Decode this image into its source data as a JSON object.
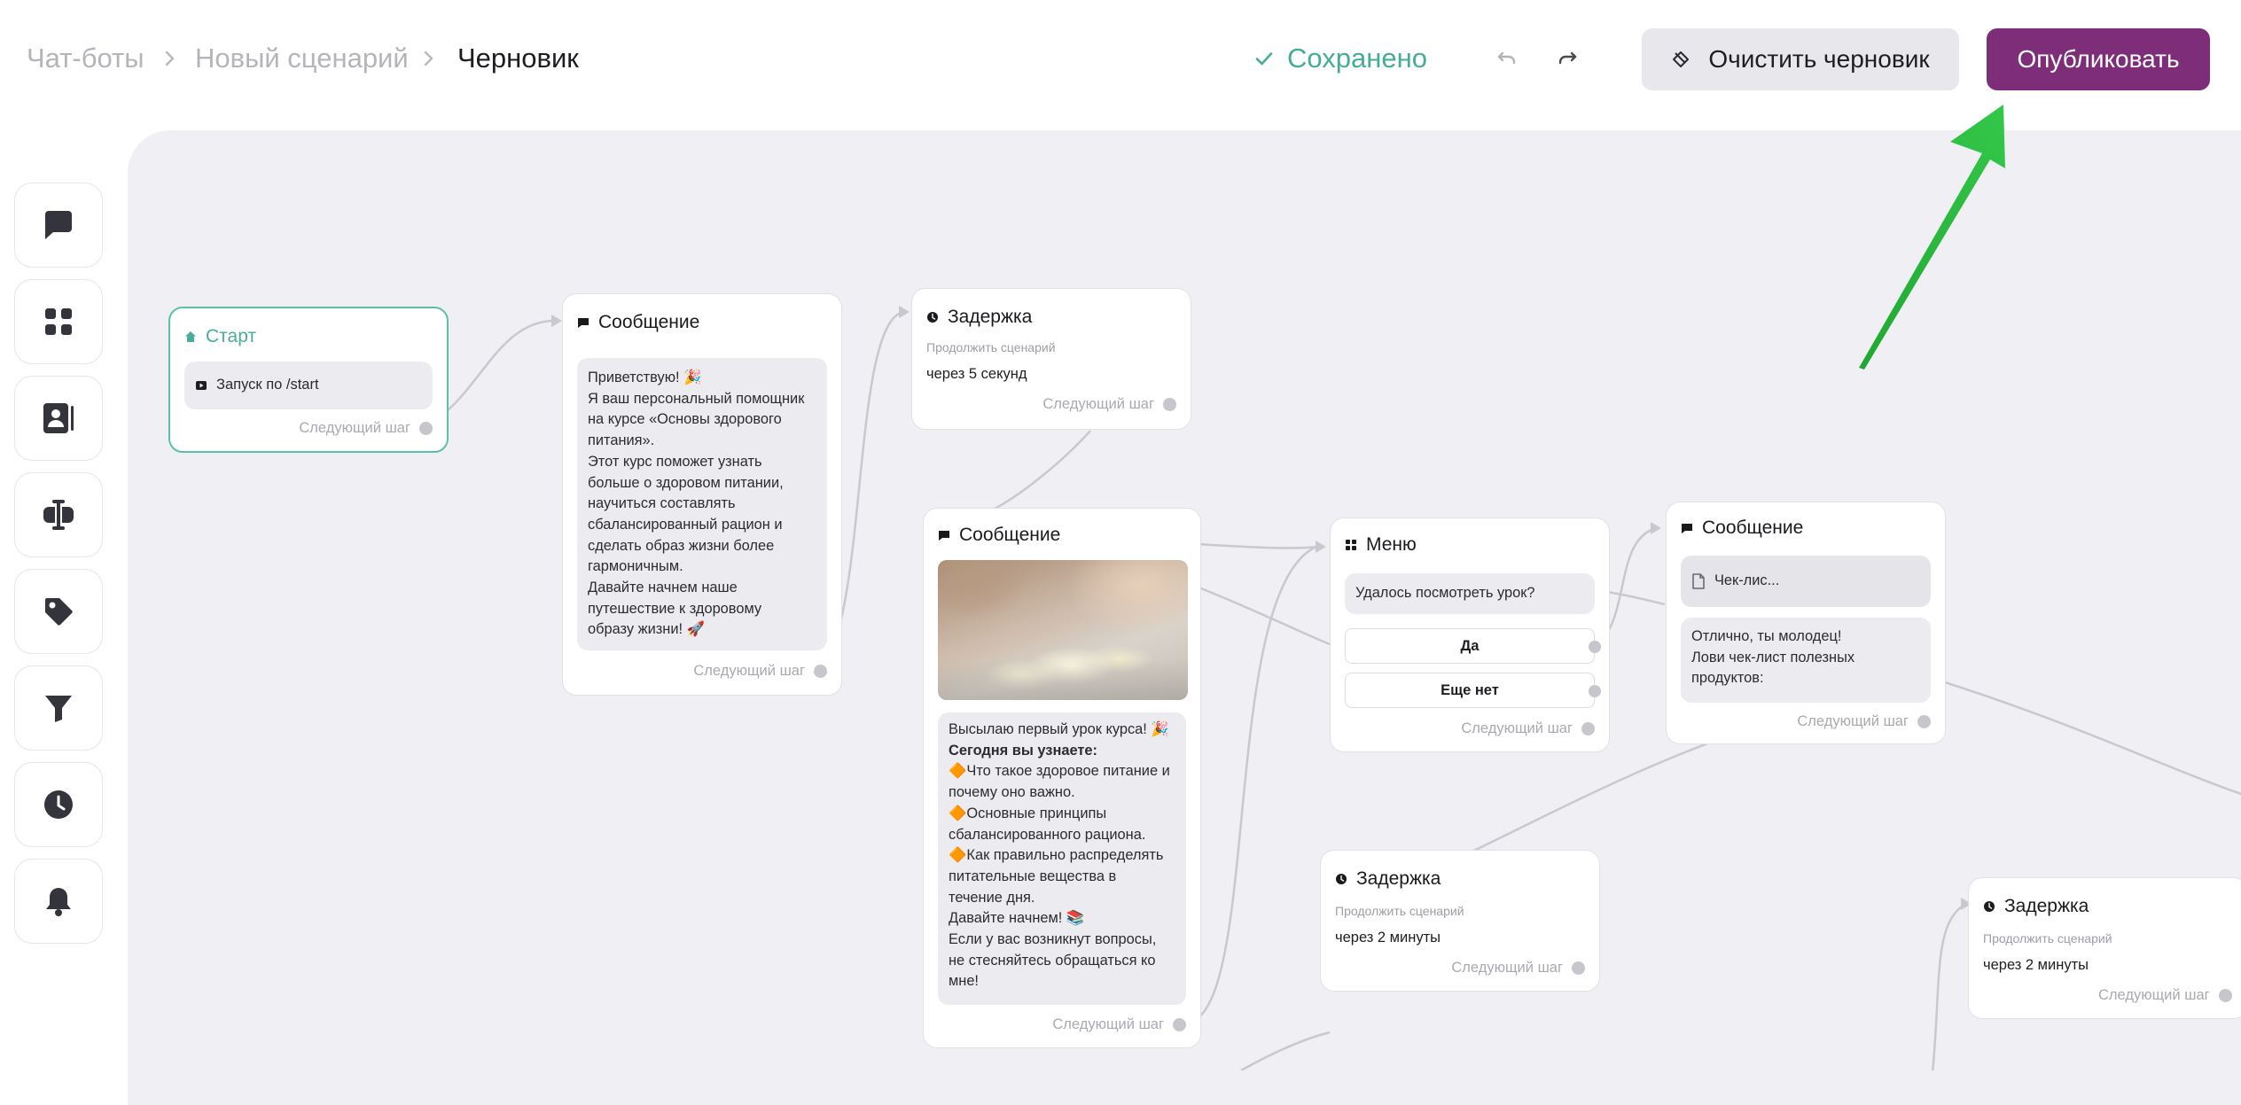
{
  "breadcrumb": {
    "items": [
      "Чат-боты",
      "Новый сценарий"
    ],
    "current": "Черновик"
  },
  "status": {
    "saved_label": "Сохранено"
  },
  "actions": {
    "clear_label": "Очистить черновик",
    "publish_label": "Опубликовать"
  },
  "colors": {
    "accent_teal": "#45ad96",
    "publish_bg": "#7e2e79",
    "annotation_arrow": "#22b33a",
    "canvas_bg": "#f0f0f4"
  },
  "toolbar": {
    "items": [
      {
        "icon": "message-icon"
      },
      {
        "icon": "menu-grid-icon"
      },
      {
        "icon": "contact-card-icon"
      },
      {
        "icon": "input-field-icon"
      },
      {
        "icon": "tag-icon"
      },
      {
        "icon": "filter-icon"
      },
      {
        "icon": "clock-icon"
      },
      {
        "icon": "bell-icon"
      }
    ]
  },
  "nodes": {
    "start": {
      "title": "Старт",
      "trigger": "Запуск по /start",
      "next": "Следующий шаг"
    },
    "message1": {
      "title": "Сообщение",
      "lines": [
        "Приветствую! 🎉",
        "Я ваш персональный помощник",
        "на курсе «Основы здорового",
        "питания».",
        "Этот курс поможет узнать",
        "больше о здоровом питании,",
        "научиться составлять",
        "сбалансированный рацион и",
        "сделать образ жизни более",
        "гармоничным.",
        "Давайте начнем наше",
        "путешествие к здоровому",
        "образу жизни! 🚀"
      ],
      "next": "Следующий шаг"
    },
    "delay1": {
      "title": "Задержка",
      "caption": "Продолжить сценарий",
      "value": "через 5 секунд",
      "next": "Следующий шаг"
    },
    "message2": {
      "title": "Сообщение",
      "intro": "Высылаю первый урок курса! 🎉",
      "heading": "Сегодня вы узнаете:",
      "lines": [
        "🔶Что такое здоровое питание и",
        "почему оно важно.",
        "🔶Основные принципы",
        "сбалансированного рациона.",
        "🔶Как правильно распределять",
        "питательные вещества в",
        "течение дня.",
        "Давайте начнем! 📚",
        "Если у вас возникнут вопросы,",
        "не стесняйтесь обращаться ко",
        "мне!"
      ],
      "next": "Следующий шаг"
    },
    "menu": {
      "title": "Меню",
      "question": "Удалось посмотреть урок?",
      "options": [
        "Да",
        "Еще нет"
      ],
      "next": "Следующий шаг"
    },
    "message3": {
      "title": "Сообщение",
      "file": "Чек-лис...",
      "lines": [
        "Отлично, ты молодец!",
        "Лови чек-лист полезных",
        "продуктов:"
      ],
      "next": "Следующий шаг"
    },
    "delay2": {
      "title": "Задержка",
      "caption": "Продолжить сценарий",
      "value": "через 2 минуты",
      "next": "Следующий шаг"
    },
    "delay3": {
      "title": "Задержка",
      "caption": "Продолжить сценарий",
      "value": "через 2 минуты",
      "next": "Следующий шаг"
    }
  }
}
